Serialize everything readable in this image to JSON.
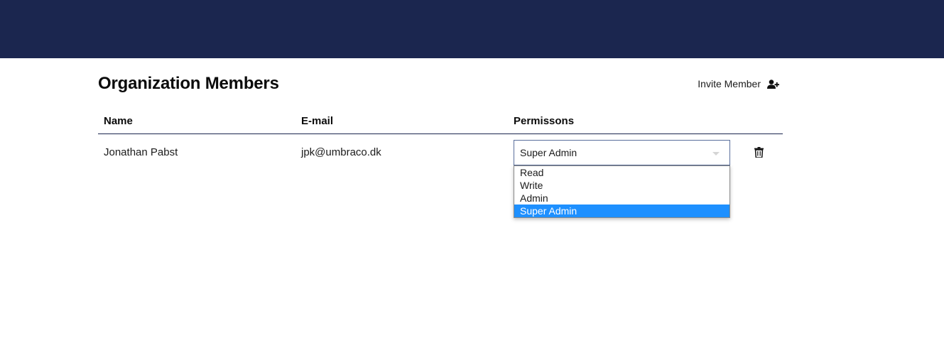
{
  "header": {
    "bg_color": "#1b264f"
  },
  "page": {
    "title": "Organization Members",
    "invite_label": "Invite Member",
    "invite_icon": "user-plus-icon"
  },
  "table": {
    "columns": [
      "Name",
      "E-mail",
      "Permissons"
    ],
    "rows": [
      {
        "name": "Jonathan Pabst",
        "email": "jpk@umbraco.dk",
        "permission": "Super Admin",
        "delete_icon": "trash-icon"
      }
    ]
  },
  "permission_dropdown": {
    "open": true,
    "options": [
      "Read",
      "Write",
      "Admin",
      "Super Admin"
    ],
    "selected": "Super Admin",
    "highlight_color": "#1e90ff"
  }
}
